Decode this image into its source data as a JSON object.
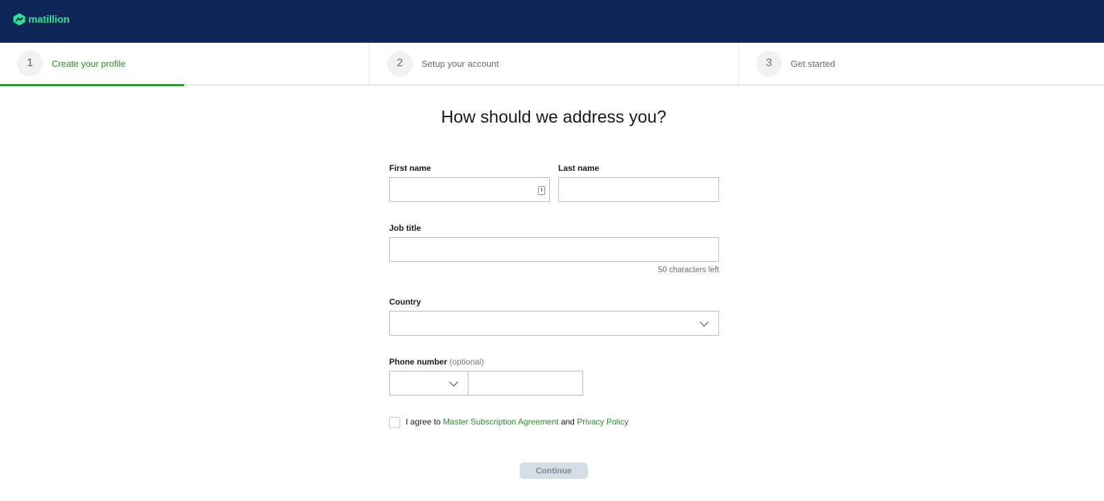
{
  "brand": {
    "name": "matillion",
    "color": "#2ee08f",
    "bar_color": "#0d2657"
  },
  "stepper": {
    "progress": 0.5,
    "steps": [
      {
        "number": "1",
        "label": "Create your profile",
        "active": true
      },
      {
        "number": "2",
        "label": "Setup your account",
        "active": false
      },
      {
        "number": "3",
        "label": "Get started",
        "active": false
      }
    ]
  },
  "form": {
    "heading": "How should we address you?",
    "first_name": {
      "label": "First name",
      "value": ""
    },
    "last_name": {
      "label": "Last name",
      "value": ""
    },
    "job_title": {
      "label": "Job title",
      "value": "",
      "counter": "50 characters left"
    },
    "country": {
      "label": "Country",
      "selected": ""
    },
    "phone": {
      "label": "Phone number",
      "optional": "(optional)",
      "code": "",
      "value": ""
    },
    "agreement": {
      "prefix": "I agree to",
      "msa_link": "Master Subscription Agreement",
      "joiner": "and",
      "privacy_link": "Privacy Policy",
      "checked": false
    },
    "continue_label": "Continue"
  },
  "icons": {
    "logo": "matillion-logo-icon",
    "autofill": "autofill-contact-icon",
    "country_dropdown": "chevron-down-icon",
    "phone_dropdown": "chevron-down-icon"
  },
  "colors": {
    "accent": "#2b8a2b",
    "progress": "#2b9a2b",
    "disabled_button": "#d5dce5"
  }
}
